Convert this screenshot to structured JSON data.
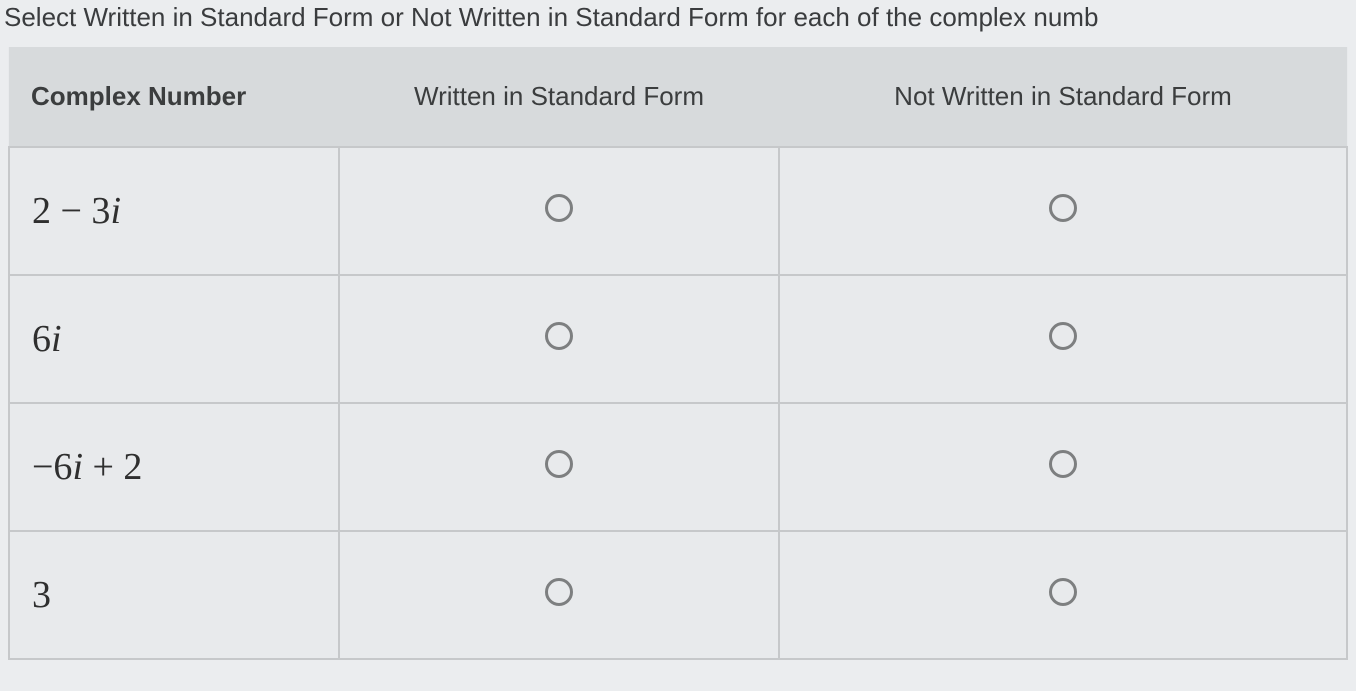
{
  "instruction": "Select Written in Standard Form or Not Written in Standard Form for each of the complex numb",
  "headers": {
    "col1": "Complex Number",
    "col2": "Written in Standard Form",
    "col3": "Not Written in Standard Form"
  },
  "rows": [
    {
      "expr_html": "2 &minus; 3<span class='italic-i'>i</span>"
    },
    {
      "expr_html": "6<span class='italic-i'>i</span>"
    },
    {
      "expr_html": "&minus;6<span class='italic-i'>i</span> + 2"
    },
    {
      "expr_html": "3"
    }
  ]
}
